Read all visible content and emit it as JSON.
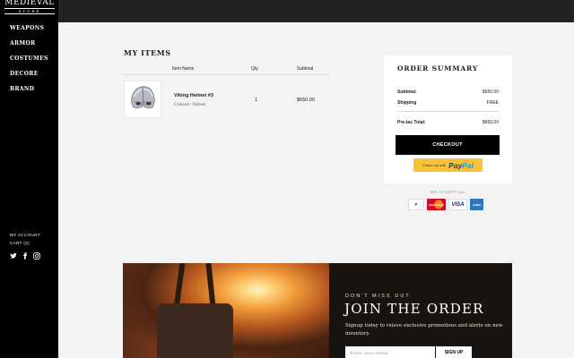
{
  "brand": {
    "name": "MEDIEVAL",
    "tagline": "STORE"
  },
  "sidebar": {
    "nav": [
      "WEAPONS",
      "ARMOR",
      "COSTUMES",
      "DECORE",
      "BRAND"
    ],
    "account_label": "MY ACCOUNT",
    "cart_label": "CART (2)",
    "social_icons": [
      "twitter-icon",
      "facebook-icon",
      "instagram-icon"
    ]
  },
  "items": {
    "title": "MY ITEMS",
    "columns": {
      "name": "Item Name",
      "qty": "Qty",
      "subtotal": "Subtotal"
    },
    "rows": [
      {
        "name": "Viking Helmet #3",
        "color": "Colour: Silver",
        "qty": "1",
        "subtotal": "$650.00"
      }
    ]
  },
  "summary": {
    "title": "ORDER SUMMARY",
    "subtotal_label": "Subtotal:",
    "subtotal_value": "$650.00",
    "shipping_label": "Shipping",
    "shipping_value": "FREE",
    "pretax_label": "Pre-tax Total:",
    "pretax_value": "$650.00",
    "checkout_label": "CHECKOUT",
    "paypal_prefix": "Check out with",
    "paypal_word_1": "Pay",
    "paypal_word_2": "Pal",
    "accept_label": "WE ACCEPT ALL",
    "cards": {
      "paypal": "P",
      "mastercard": "MasterCard",
      "visa": "VISA",
      "amex": "AMEX"
    }
  },
  "banner": {
    "subtitle": "DON'T MISS OUT",
    "title": "JOIN THE ORDER",
    "text": "Signup today to reieve exclusive promotions and alerts on new inventory.",
    "email_placeholder": "Enter your email",
    "signup_label": "SIGN UP"
  },
  "colors": {
    "sidebar": "#000000",
    "topbar": "#232323",
    "page": "#f3f3f3",
    "paypal": "#f7c23a"
  }
}
